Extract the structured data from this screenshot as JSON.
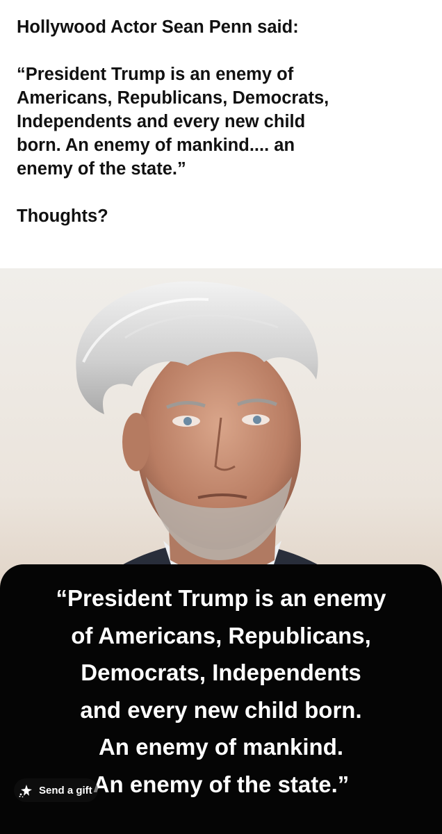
{
  "post": {
    "line1": "Hollywood Actor Sean Penn said:",
    "quote_lines": [
      "“President Trump is an enemy of",
      "Americans, Republicans, Democrats,",
      "Independents and every new child",
      "born. An enemy of mankind.... an",
      "enemy of the state.”"
    ],
    "question": "Thoughts?"
  },
  "image_caption": {
    "lines": [
      "“President Trump is an enemy",
      "of Americans, Republicans,",
      "Democrats, Independents",
      "and every new child born.",
      "An enemy of mankind.",
      "An enemy of the state.”"
    ]
  },
  "gift_button": {
    "label": "Send a gift",
    "icon": "gift-sparkle-icon"
  },
  "colors": {
    "caption_bg": "#050505",
    "text": "#111111",
    "caption_text": "#ffffff"
  }
}
